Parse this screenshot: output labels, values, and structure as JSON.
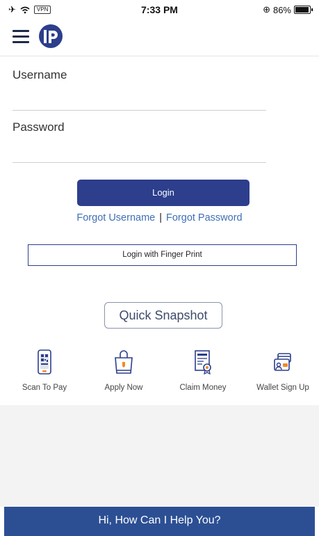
{
  "status_bar": {
    "vpn": "VPN",
    "time": "7:33 PM",
    "battery": "86%"
  },
  "form": {
    "username_label": "Username",
    "password_label": "Password",
    "login_label": "Login",
    "forgot_username": "Forgot Username",
    "separator": "|",
    "forgot_password": "Forgot Password",
    "fingerprint_label": "Login with Finger Print"
  },
  "snapshot_label": "Quick Snapshot",
  "quick_actions": [
    {
      "label": "Scan To Pay",
      "icon": "qr-phone-icon"
    },
    {
      "label": "Apply Now",
      "icon": "shopping-bag-icon"
    },
    {
      "label": "Claim Money",
      "icon": "certificate-icon"
    },
    {
      "label": "Wallet Sign Up",
      "icon": "wallet-icon"
    }
  ],
  "help_bar": {
    "text": "Hi, How Can I Help You?"
  },
  "colors": {
    "primary": "#2c3e8c",
    "link": "#3f6fb5",
    "help_bar": "#2c4f94",
    "accent": "#f08a24"
  }
}
